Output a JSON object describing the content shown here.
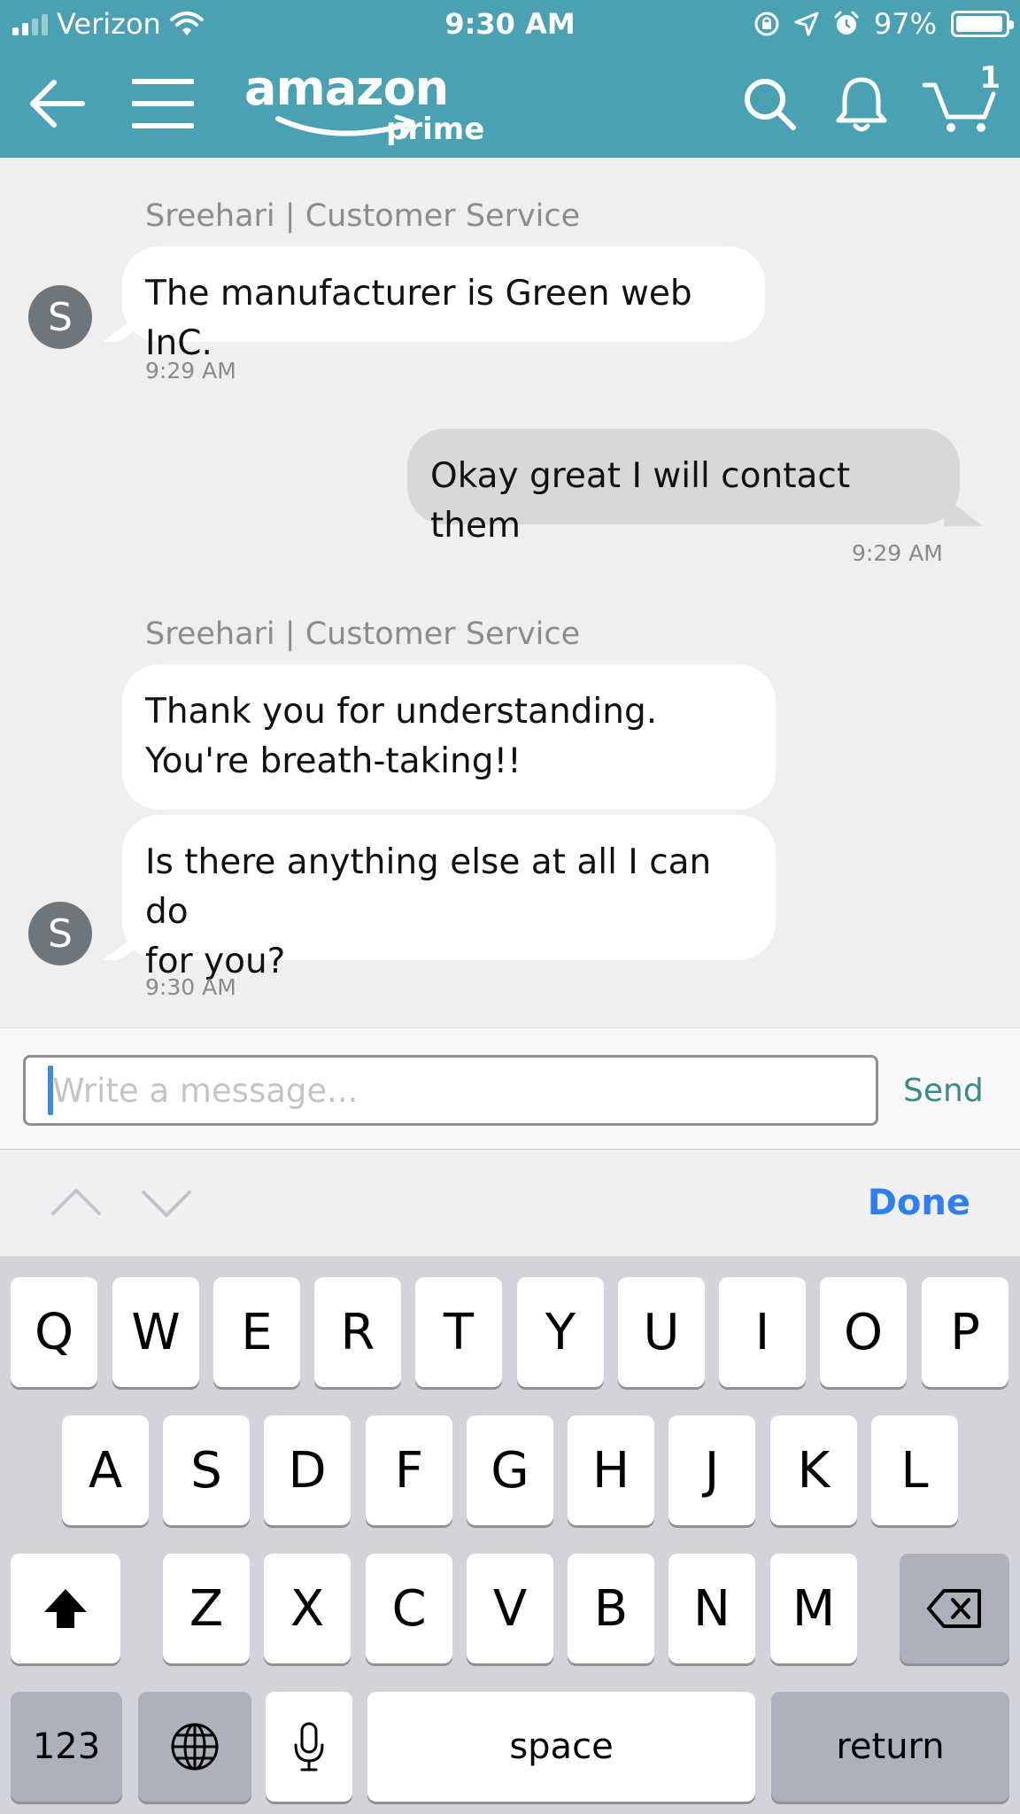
{
  "status": {
    "carrier": "Verizon",
    "time": "9:30 AM",
    "battery": "97%",
    "battery_level": 0.97
  },
  "nav": {
    "logo_word": "amazon",
    "logo_sub": "prime",
    "cart_count": "1",
    "icons": [
      "back-arrow-icon",
      "menu-icon",
      "search-icon",
      "bell-icon",
      "cart-icon"
    ]
  },
  "chat": {
    "messages": [
      {
        "sender": "Sreehari | Customer Service",
        "text": "The manufacturer is Green web InC.",
        "time": "9:29 AM",
        "direction": "in"
      },
      {
        "text": "Okay great I will contact them",
        "time": "9:29 AM",
        "direction": "out"
      },
      {
        "sender": "Sreehari | Customer Service",
        "lines": [
          "Thank you for understanding.",
          "You're breath-taking!!"
        ],
        "direction": "in"
      },
      {
        "lines": [
          "Is there anything else at all I can do",
          "for you?"
        ],
        "time": "9:30 AM",
        "direction": "in"
      }
    ],
    "avatar_letter": "S"
  },
  "composer": {
    "placeholder": "Write a message...",
    "value": "",
    "send_label": "Send"
  },
  "accessory": {
    "done_label": "Done"
  },
  "keyboard": {
    "row1": [
      "Q",
      "W",
      "E",
      "R",
      "T",
      "Y",
      "U",
      "I",
      "O",
      "P"
    ],
    "row2": [
      "A",
      "S",
      "D",
      "F",
      "G",
      "H",
      "J",
      "K",
      "L"
    ],
    "row3": [
      "Z",
      "X",
      "C",
      "V",
      "B",
      "N",
      "M"
    ],
    "numbers_label": "123",
    "space_label": "space",
    "return_label": "return"
  }
}
